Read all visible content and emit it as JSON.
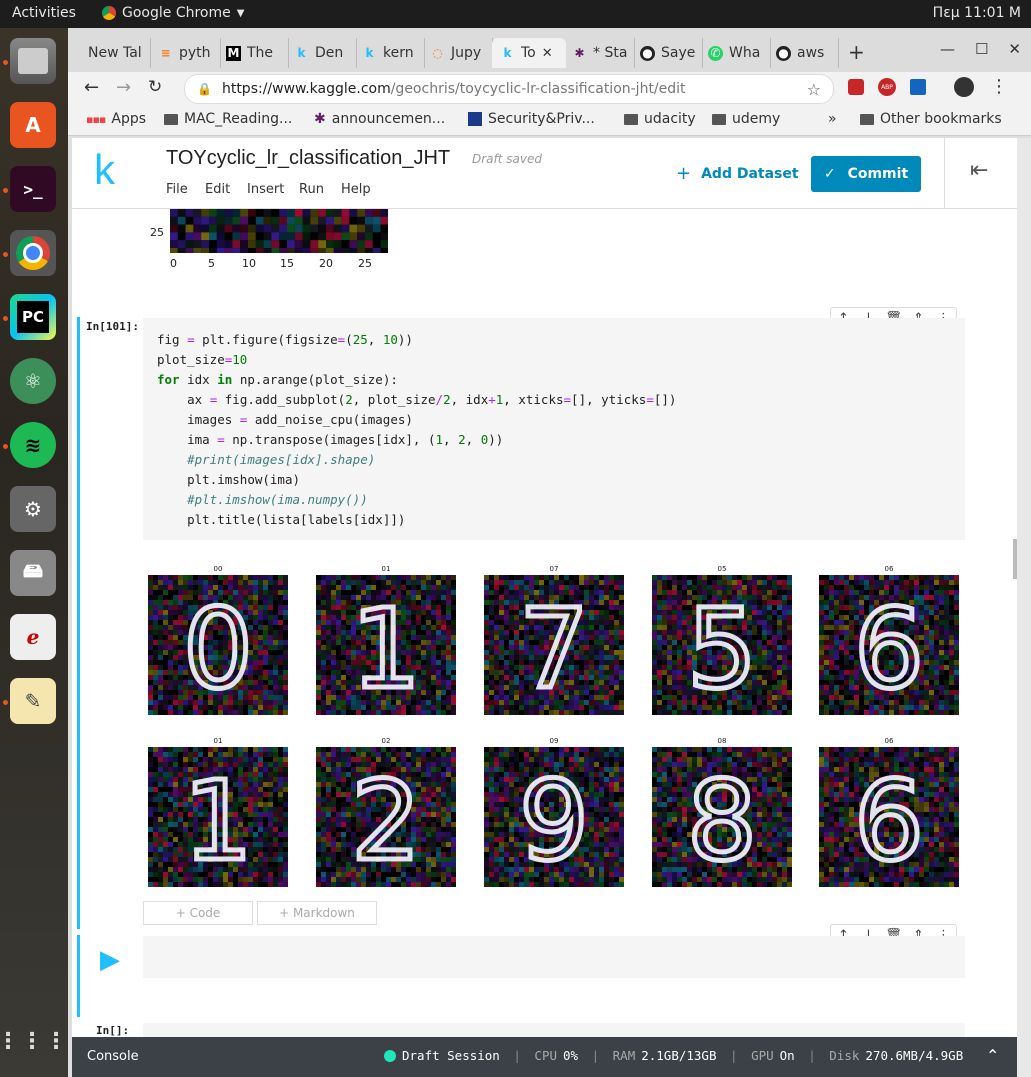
{
  "os": {
    "activities": "Activities",
    "app_name": "Google Chrome",
    "clock": "Πεμ 11:01 Μ"
  },
  "browser": {
    "tabs": [
      {
        "label": "New Tal",
        "icon": "chrome-icon"
      },
      {
        "label": "pyth",
        "icon": "stackoverflow-icon"
      },
      {
        "label": "The",
        "icon": "medium-icon"
      },
      {
        "label": "Den",
        "icon": "kaggle-icon"
      },
      {
        "label": "kern",
        "icon": "kaggle-icon"
      },
      {
        "label": "Jupy",
        "icon": "jupyter-icon"
      },
      {
        "label": "To",
        "icon": "kaggle-icon"
      },
      {
        "label": "* Sta",
        "icon": "slack-icon"
      },
      {
        "label": "Saye",
        "icon": "github-icon"
      },
      {
        "label": "Wha",
        "icon": "whatsapp-icon"
      },
      {
        "label": "aws",
        "icon": "github-icon"
      }
    ],
    "url_prefix": "https://www.kaggle.com",
    "url_path": "/geochris/toycyclic-lr-classification-jht/edit",
    "bookmarks": [
      "Apps",
      "MAC_Reading...",
      "announcemen...",
      "Security&Priv...",
      "udacity",
      "udemy"
    ],
    "bookmarks_more": "»",
    "other_bookmarks": "Other bookmarks"
  },
  "kaggle": {
    "notebook_title": "TOYcyclic_lr_classification_JHT",
    "draft_status": "Draft saved",
    "menu": [
      "File",
      "Edit",
      "Insert",
      "Run",
      "Help"
    ],
    "add_dataset": "Add Dataset",
    "commit": "Commit"
  },
  "prev_output": {
    "ytick": "25",
    "xticks": [
      "0",
      "5",
      "10",
      "15",
      "20",
      "25"
    ]
  },
  "cell": {
    "prompt": "In[101]:",
    "code_lines": [
      "fig = plt.figure(figsize=(25, 10))",
      "plot_size=10",
      "for idx in np.arange(plot_size):",
      "    ax = fig.add_subplot(2, plot_size/2, idx+1, xticks=[], yticks=[])",
      "    images = add_noise_cpu(images)",
      "    ima = np.transpose(images[idx], (1, 2, 0))",
      "    #print(images[idx].shape)",
      "    plt.imshow(ima)",
      "    #plt.imshow(ima.numpy())",
      "    plt.title(lista[labels[idx]])"
    ],
    "output_titles": [
      "00",
      "01",
      "07",
      "05",
      "06",
      "01",
      "02",
      "09",
      "08",
      "06"
    ],
    "output_digits": [
      "0",
      "1",
      "7",
      "5",
      "6",
      "1",
      "2",
      "9",
      "8",
      "6"
    ]
  },
  "add_code": "+ Code",
  "add_markdown": "+ Markdown",
  "next_prompt": "In[]:",
  "status": {
    "console": "Console",
    "session": "Draft Session",
    "cpu_label": "CPU",
    "cpu": "0%",
    "ram_label": "RAM",
    "ram": "2.1GB/13GB",
    "gpu_label": "GPU",
    "gpu": "On",
    "disk_label": "Disk",
    "disk": "270.6MB/4.9GB"
  },
  "colors": {
    "kaggle_blue": "#20beff",
    "commit_blue": "#008abc",
    "status_bar": "#3b4147",
    "session_green": "#1de9b6"
  }
}
